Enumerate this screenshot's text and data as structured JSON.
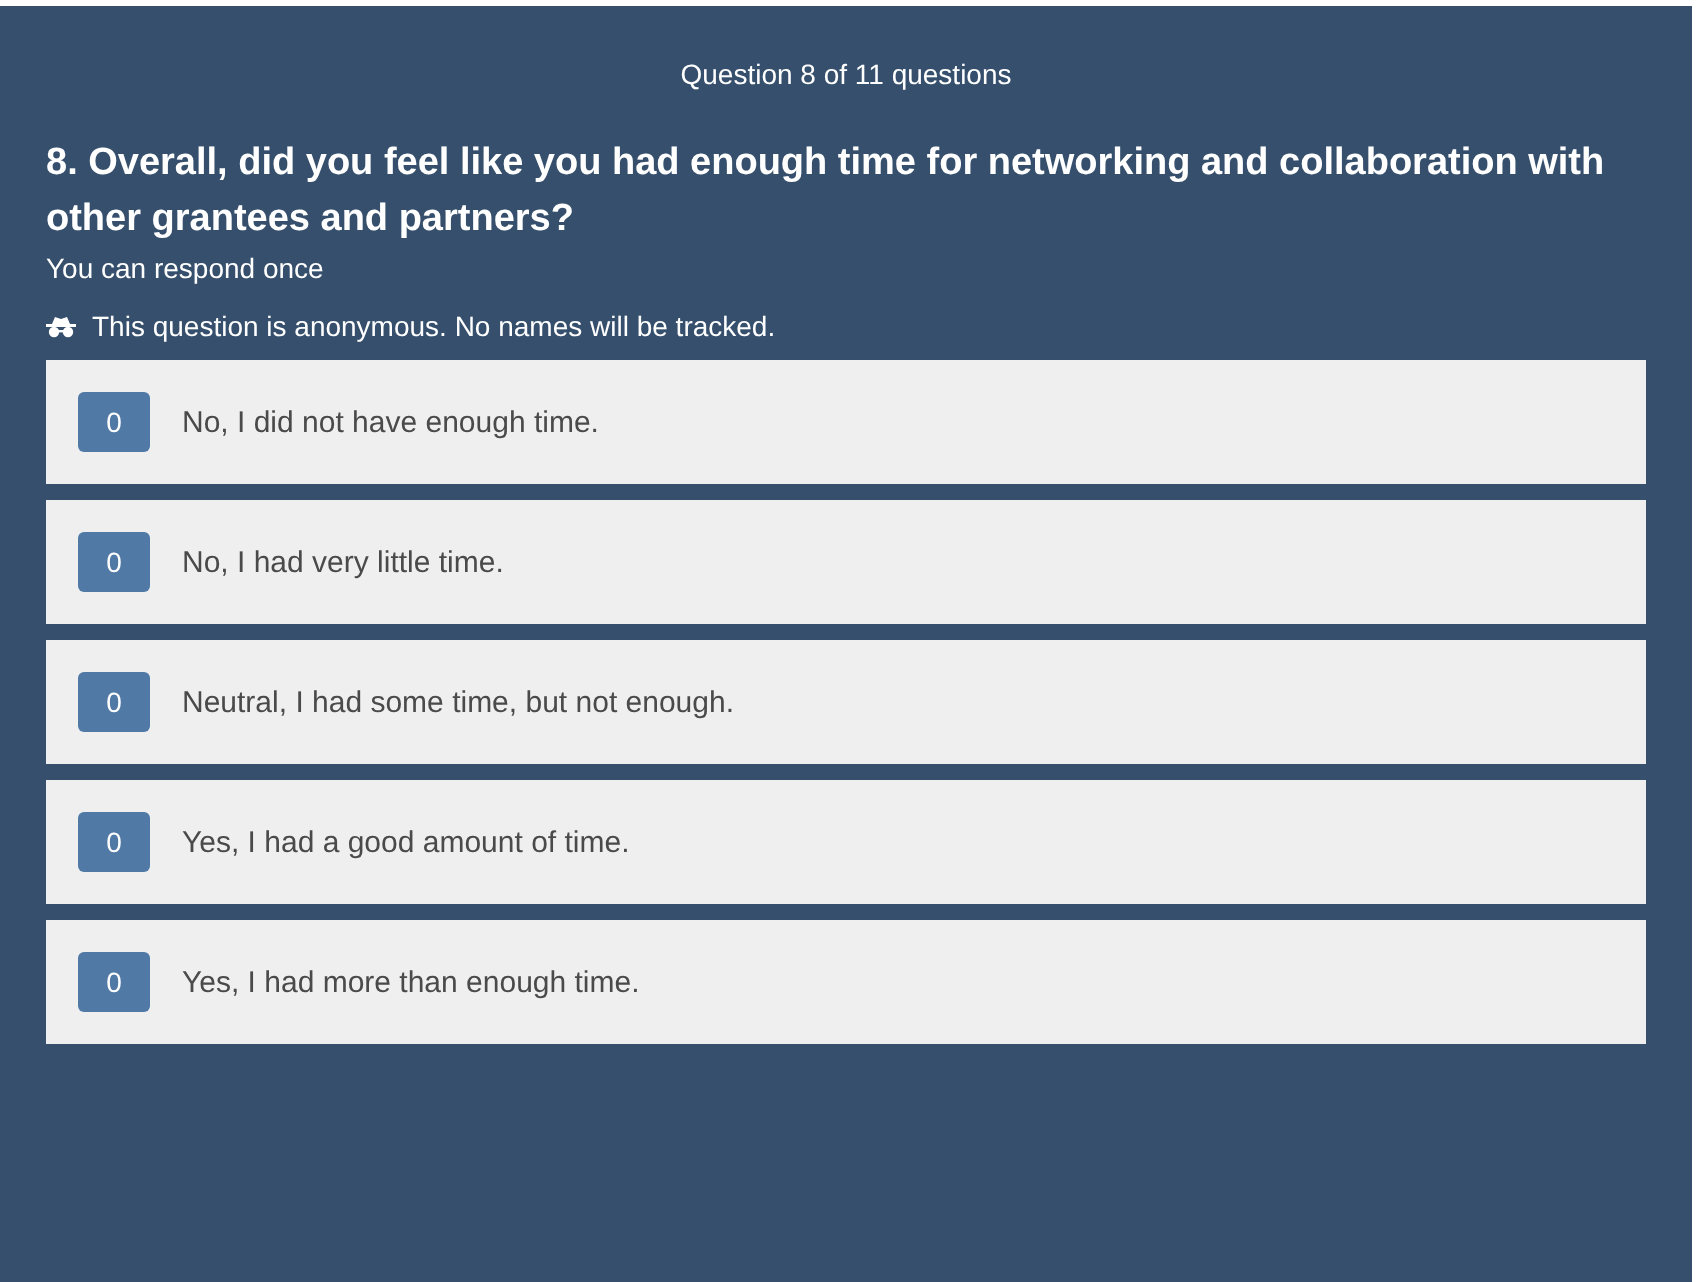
{
  "progress": "Question 8 of 11 questions",
  "question": {
    "title": "8. Overall, did you feel like you had enough time for networking and collaboration with other grantees and partners?",
    "hint": "You can respond once",
    "notice": "This question is anonymous. No names will be tracked."
  },
  "options": [
    {
      "count": "0",
      "label": "No, I did not have enough time."
    },
    {
      "count": "0",
      "label": "No, I had very little time."
    },
    {
      "count": "0",
      "label": "Neutral, I had some time, but not enough."
    },
    {
      "count": "0",
      "label": "Yes, I had a good amount of time."
    },
    {
      "count": "0",
      "label": "Yes, I had more than enough time."
    }
  ]
}
